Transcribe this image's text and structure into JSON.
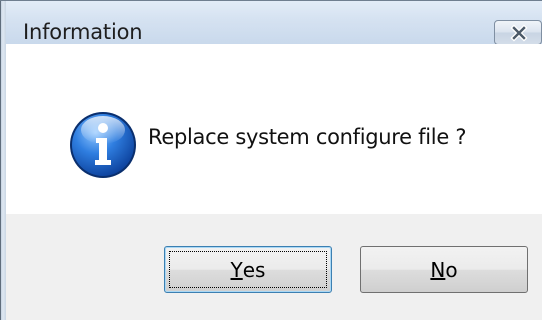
{
  "window": {
    "title": "Information"
  },
  "titlebar": {
    "close_icon": "close-icon"
  },
  "dialog": {
    "icon": "info-icon",
    "message": "Replace system configure file ?"
  },
  "buttons": {
    "yes": {
      "accel": "Y",
      "rest": "es",
      "default": true
    },
    "no": {
      "accel": "N",
      "rest": "o",
      "default": false
    }
  },
  "colors": {
    "titlebar": "#d5e2f1",
    "button_area": "#f0f0f0",
    "info_icon": "#1f63c6"
  }
}
